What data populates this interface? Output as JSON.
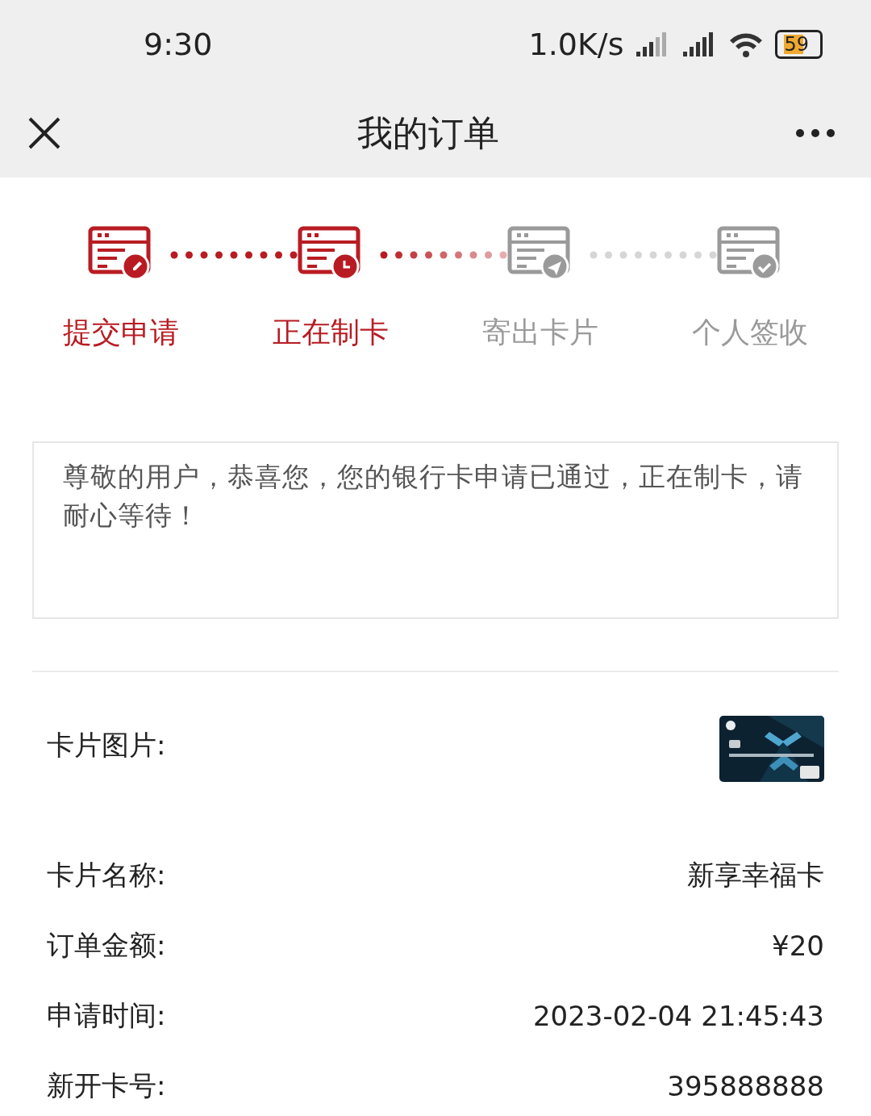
{
  "status_bar": {
    "time": "9:30",
    "speed": "1.0K/s",
    "battery": "59"
  },
  "nav": {
    "title": "我的订单"
  },
  "steps": [
    {
      "label": "提交申请",
      "reached": true,
      "kind": "edit"
    },
    {
      "label": "正在制卡",
      "reached": true,
      "kind": "clock"
    },
    {
      "label": "寄出卡片",
      "reached": false,
      "kind": "send"
    },
    {
      "label": "个人签收",
      "reached": false,
      "kind": "check"
    }
  ],
  "notice": "尊敬的用户，恭喜您，您的银行卡申请已通过，正在制卡，请耐心等待！",
  "details": [
    {
      "label": "卡片图片:",
      "kind": "picture"
    },
    {
      "label": "卡片名称:",
      "value": "新享幸福卡"
    },
    {
      "label": "订单金额:",
      "value": "¥20"
    },
    {
      "label": "申请时间:",
      "value": "2023-02-04 21:45:43"
    },
    {
      "label": "新开卡号:",
      "value": "395888888"
    }
  ]
}
